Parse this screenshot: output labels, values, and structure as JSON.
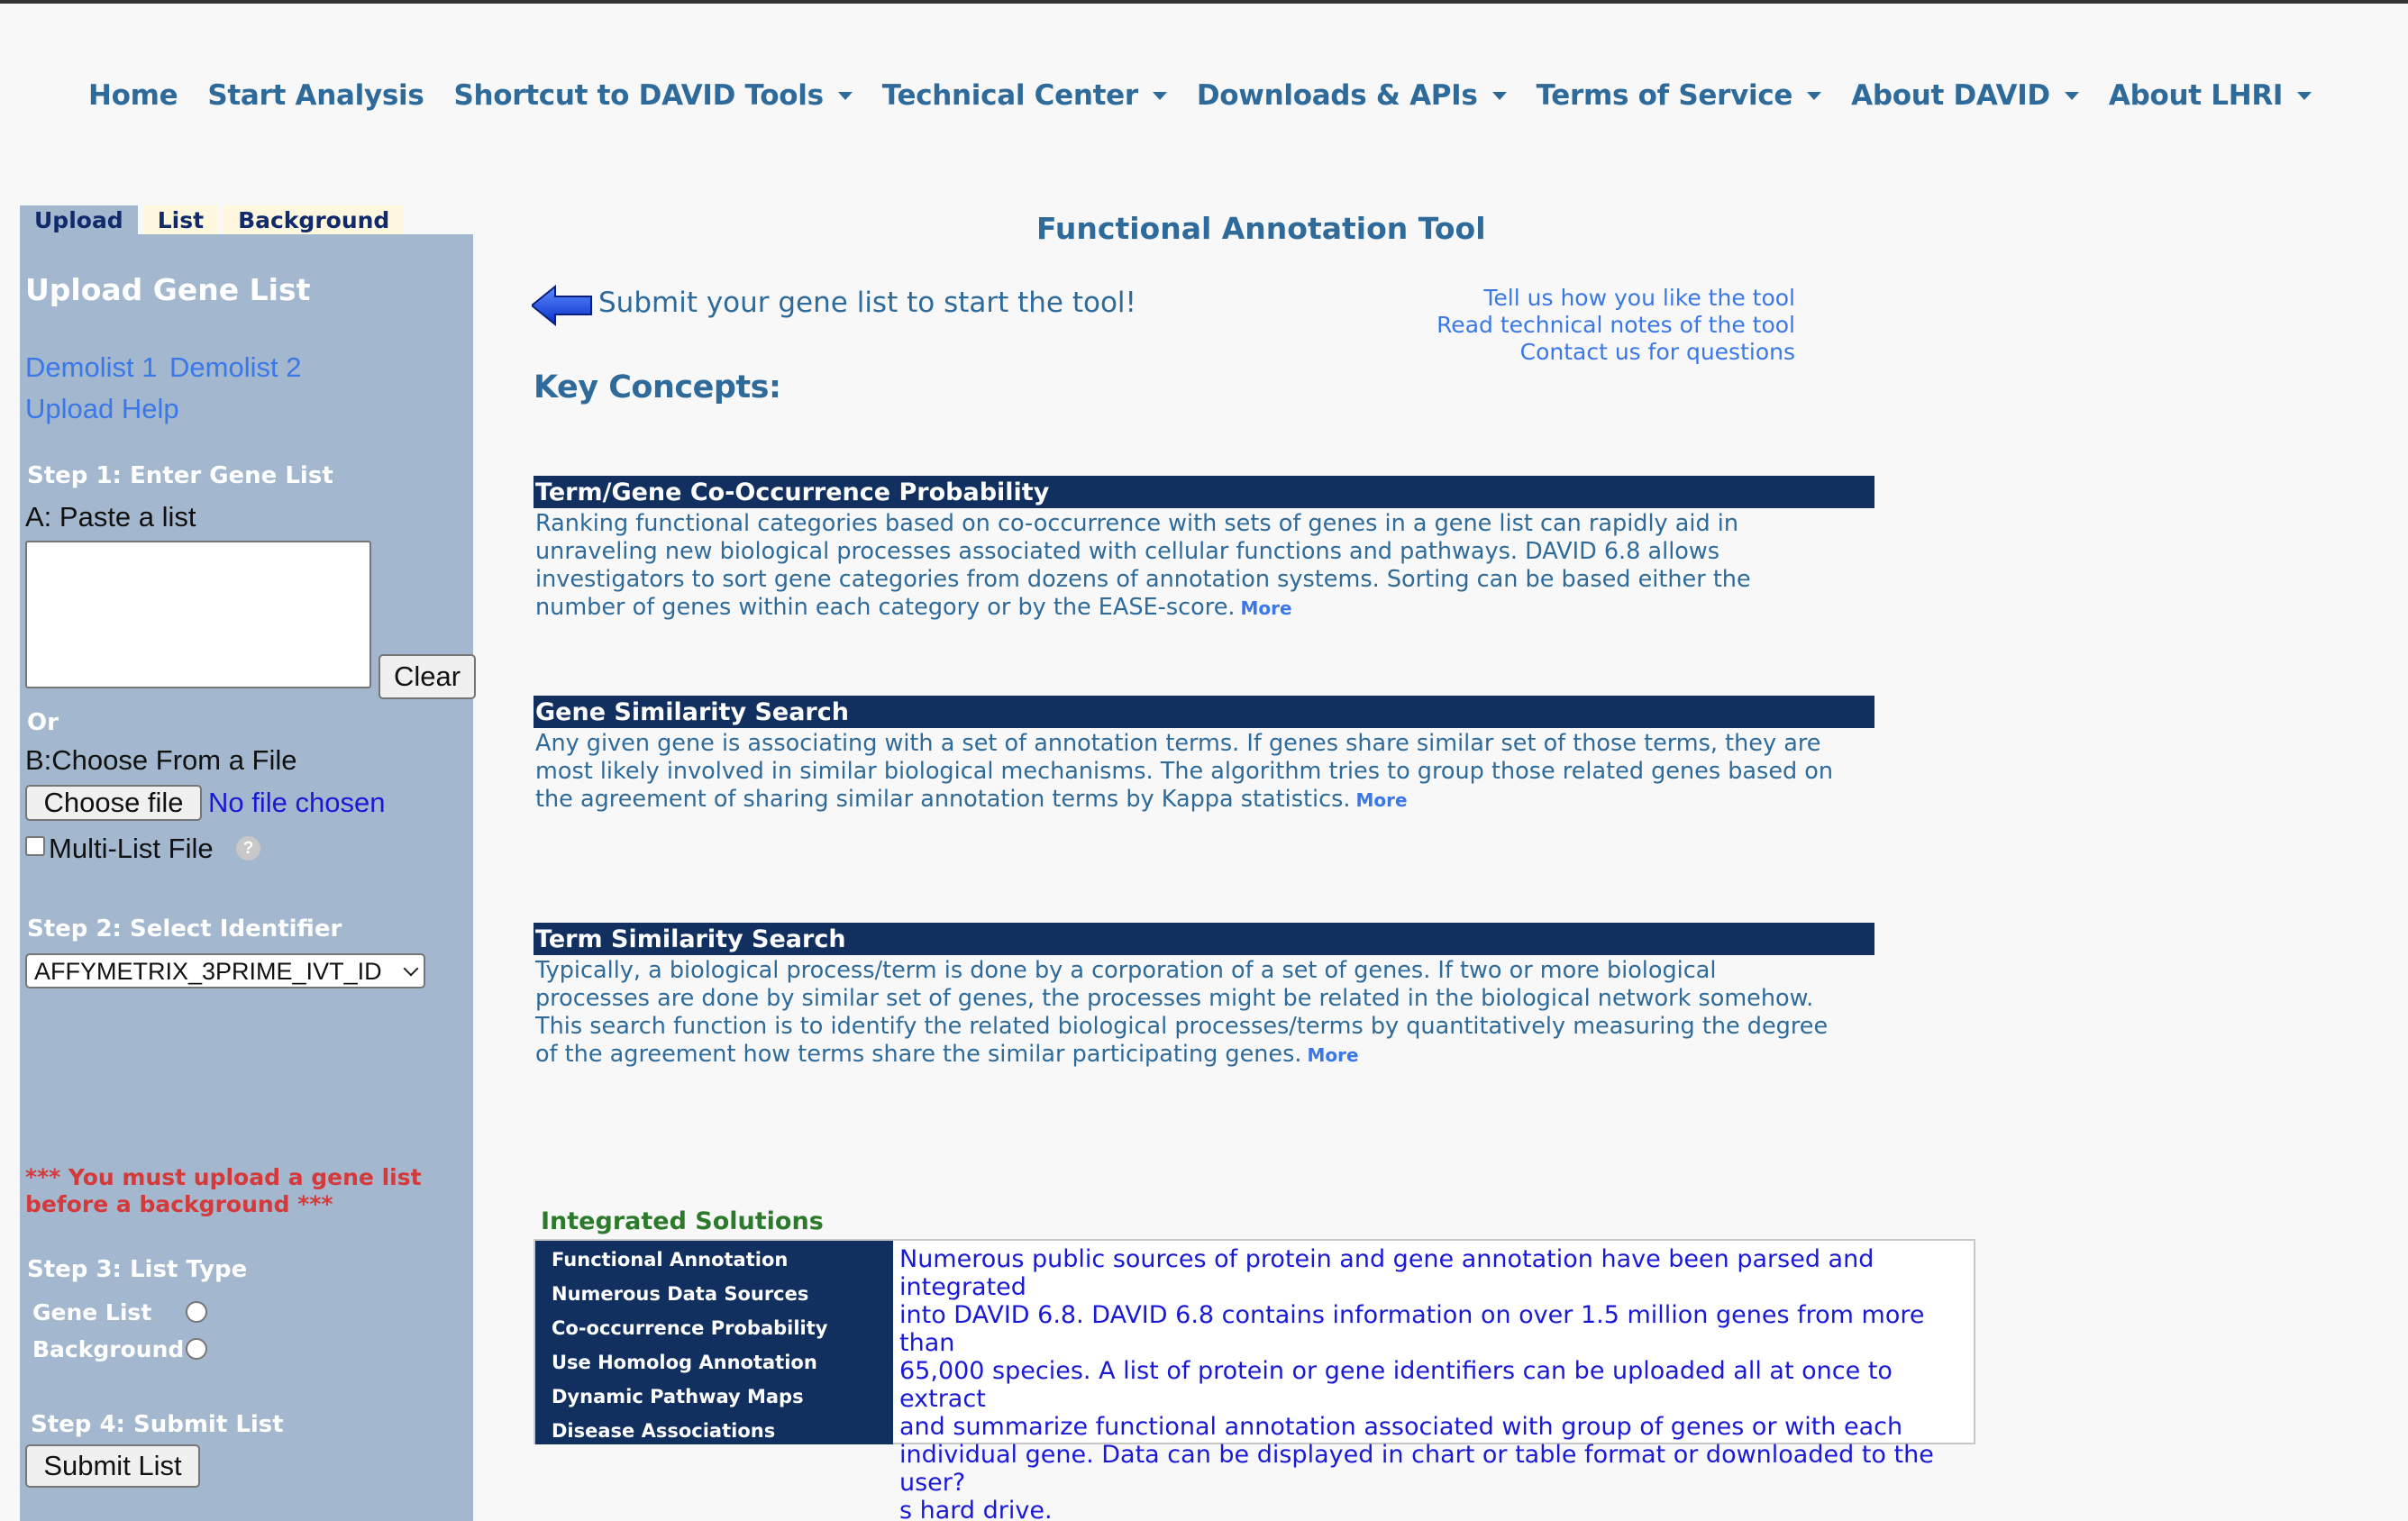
{
  "nav": {
    "items": [
      {
        "label": "Home",
        "dropdown": false
      },
      {
        "label": "Start Analysis",
        "dropdown": false
      },
      {
        "label": "Shortcut to DAVID Tools",
        "dropdown": true
      },
      {
        "label": "Technical Center",
        "dropdown": true
      },
      {
        "label": "Downloads & APIs",
        "dropdown": true
      },
      {
        "label": "Terms of Service",
        "dropdown": true
      },
      {
        "label": "About DAVID",
        "dropdown": true
      },
      {
        "label": "About LHRI",
        "dropdown": true
      }
    ]
  },
  "sidebar": {
    "tabs": [
      "Upload",
      "List",
      "Background"
    ],
    "active_tab": "Upload",
    "title": "Upload Gene List",
    "demolist1": "Demolist 1",
    "demolist2": "Demolist 2",
    "upload_help": "Upload Help",
    "step1": "Step 1: Enter Gene List",
    "paste_label": "A: Paste a list",
    "clear_button": "Clear",
    "or_label": "Or",
    "choose_label": "B:Choose From a File",
    "choose_file_button": "Choose file",
    "no_file": "No file chosen",
    "multi_list": "Multi-List File",
    "help_glyph": "?",
    "step2": "Step 2: Select Identifier",
    "identifier_selected": "AFFYMETRIX_3PRIME_IVT_ID",
    "warning_line1": "*** You must upload a gene list",
    "warning_line2": "before a background ***",
    "step3": "Step 3: List Type",
    "gene_list_option": "Gene List",
    "background_option": "Background",
    "step4": "Step 4: Submit List",
    "submit_button": "Submit List"
  },
  "main": {
    "title": "Functional Annotation Tool",
    "submit_message": "Submit your gene list to start the tool!",
    "links": [
      "Tell us how you like the tool",
      "Read technical notes of the tool",
      "Contact us for questions"
    ],
    "key_concepts": "Key Concepts:",
    "more_label": "More",
    "sections": [
      {
        "title": "Term/Gene Co-Occurrence Probability",
        "lines": [
          "Ranking functional categories based on co-occurrence with sets of genes in a gene list can rapidly aid in",
          "unraveling new biological processes associated with cellular functions and pathways. DAVID 6.8 allows",
          "investigators to sort gene categories from dozens of annotation systems. Sorting can be based either the",
          "number of genes within each category or by the EASE-score."
        ]
      },
      {
        "title": "Gene Similarity Search",
        "lines": [
          "Any given gene is associating with a set of annotation terms. If genes share similar set of those terms, they are",
          "most likely involved in similar biological mechanisms. The algorithm tries to group those related genes based on",
          "the agreement of sharing similar annotation terms by Kappa statistics."
        ]
      },
      {
        "title": "Term Similarity Search",
        "lines": [
          "Typically, a biological process/term is done by a corporation of a set of genes. If two or more biological",
          "processes are done by similar set of genes, the processes might be related in the biological network somehow.",
          "This search function is to identify the related biological processes/terms by quantitatively measuring the degree",
          "of the agreement how terms share the similar participating genes."
        ]
      }
    ],
    "integrated": {
      "title": "Integrated Solutions",
      "items": [
        "Functional Annotation",
        "Numerous Data Sources",
        "Co-occurrence Probability",
        "Use Homolog Annotation",
        "Dynamic Pathway Maps",
        "Disease Associations"
      ],
      "description_lines": [
        "Numerous public sources of protein and gene annotation have been parsed and integrated",
        "into DAVID 6.8. DAVID 6.8 contains information on over 1.5 million genes from more than",
        "65,000 species. A list of protein or gene identifiers can be uploaded all at once to extract",
        "and summarize functional annotation associated with group of genes or with each",
        "individual gene. Data can be displayed in chart or table format or downloaded to the user?",
        "s hard drive."
      ]
    }
  },
  "colors": {
    "nav_text": "#2e6a9a",
    "sidebar_bg": "#a3b7cf",
    "section_header_bg": "#12305f",
    "link_blue": "#3a78e8",
    "warning_red": "#d43a3a",
    "integrated_green": "#2d7a2d"
  }
}
